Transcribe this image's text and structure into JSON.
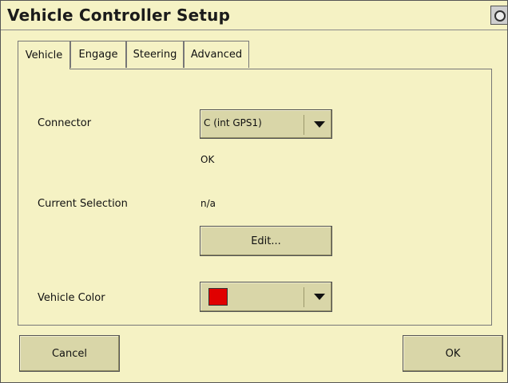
{
  "window": {
    "title": "Vehicle Controller Setup"
  },
  "tabs": [
    {
      "label": "Vehicle"
    },
    {
      "label": "Engage"
    },
    {
      "label": "Steering"
    },
    {
      "label": "Advanced"
    }
  ],
  "vehicle_tab": {
    "connector_label": "Connector",
    "connector_value": "C (int GPS1)",
    "connector_status": "OK",
    "current_selection_label": "Current Selection",
    "current_selection_value": "n/a",
    "edit_button_label": "Edit...",
    "vehicle_color_label": "Vehicle Color",
    "vehicle_color": "#e00000"
  },
  "footer": {
    "cancel_label": "Cancel",
    "ok_label": "OK"
  },
  "colors": {
    "background": "#f5f2c4",
    "button": "#d9d6a8"
  }
}
